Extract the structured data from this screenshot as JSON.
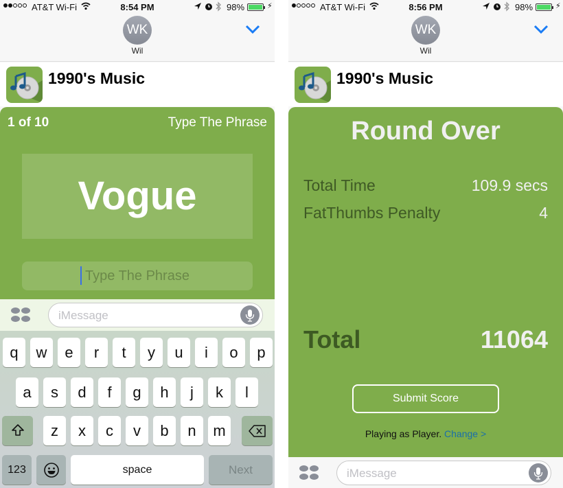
{
  "left": {
    "status": {
      "carrier": "AT&T Wi-Fi",
      "signal_filled": 2,
      "signal_total": 5,
      "time": "8:54 PM",
      "battery": "98%"
    },
    "contact": {
      "initials": "WK",
      "name": "Wil"
    },
    "app": {
      "title": "1990's Music"
    },
    "game": {
      "counter": "1 of 10",
      "mode": "Type The Phrase",
      "phrase": "Vogue",
      "input_placeholder": "Type The Phrase",
      "input_value": ""
    },
    "message_bar": {
      "placeholder": "iMessage"
    },
    "keyboard": {
      "row1": [
        "q",
        "w",
        "e",
        "r",
        "t",
        "y",
        "u",
        "i",
        "o",
        "p"
      ],
      "row2": [
        "a",
        "s",
        "d",
        "f",
        "g",
        "h",
        "j",
        "k",
        "l"
      ],
      "row3": [
        "z",
        "x",
        "c",
        "v",
        "b",
        "n",
        "m"
      ],
      "shift": "⇧",
      "delete": "⌫",
      "numbers": "123",
      "emoji": "☺",
      "space": "space",
      "next": "Next"
    }
  },
  "right": {
    "status": {
      "carrier": "AT&T Wi-Fi",
      "signal_filled": 1,
      "signal_total": 5,
      "time": "8:56 PM",
      "battery": "98%"
    },
    "contact": {
      "initials": "WK",
      "name": "Wil"
    },
    "app": {
      "title": "1990's Music"
    },
    "results": {
      "title": "Round Over",
      "rows": [
        {
          "label": "Total Time",
          "value": "109.9 secs"
        },
        {
          "label": "FatThumbs Penalty",
          "value": "4"
        }
      ],
      "total_label": "Total",
      "total_value": "11064",
      "submit_label": "Submit Score",
      "playing_text": "Playing as Player.",
      "change_link": "Change >"
    },
    "message_bar": {
      "placeholder": "iMessage"
    }
  },
  "colors": {
    "panel_green": "#7fad4b",
    "link_blue": "#1a6fa8",
    "ios_blue": "#1a7cf5",
    "battery_green": "#4cd964"
  }
}
